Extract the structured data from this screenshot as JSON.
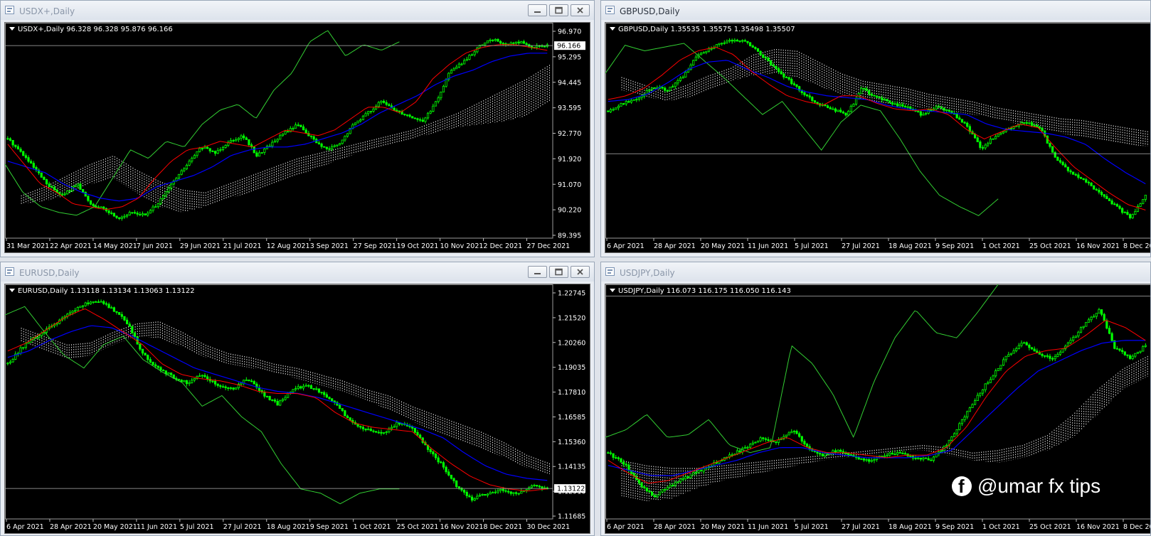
{
  "windows": [
    {
      "id": "usdx",
      "title": "USDX+,Daily",
      "active": false,
      "buttons": true,
      "info": "USDX+,Daily  96.328 96.328 95.876 96.166",
      "price_labels": [
        "96.970",
        "95.295",
        "94.445",
        "93.595",
        "92.770",
        "91.920",
        "91.070",
        "90.220",
        "89.395"
      ],
      "current_price": "96.166",
      "date_labels": [
        "31 Mar 2021",
        "22 Apr 2021",
        "14 May 2021",
        "7 Jun 2021",
        "29 Jun 2021",
        "21 Jul 2021",
        "12 Aug 2021",
        "3 Sep 2021",
        "27 Sep 2021",
        "19 Oct 2021",
        "10 Nov 2021",
        "2 Dec 2021",
        "27 Dec 2021"
      ]
    },
    {
      "id": "gbpusd",
      "title": "GBPUSD,Daily",
      "active": true,
      "buttons": false,
      "info": "GBPUSD,Daily  1.35535 1.35575 1.35498 1.35507",
      "price_labels": [],
      "current_price": "",
      "date_labels": [
        "6 Apr 2021",
        "28 Apr 2021",
        "20 May 2021",
        "11 Jun 2021",
        "5 Jul 2021",
        "27 Jul 2021",
        "18 Aug 2021",
        "9 Sep 2021",
        "1 Oct 2021",
        "25 Oct 2021",
        "16 Nov 2021",
        "8 Dec 20"
      ]
    },
    {
      "id": "eurusd",
      "title": "EURUSD,Daily",
      "active": false,
      "buttons": true,
      "info": "EURUSD,Daily  1.13118 1.13134 1.13063 1.13122",
      "price_labels": [
        "1.22745",
        "1.21520",
        "1.20260",
        "1.19035",
        "1.17810",
        "1.16585",
        "1.15360",
        "1.14135",
        "1.12910",
        "1.11685"
      ],
      "current_price": "1.13122",
      "date_labels": [
        "6 Apr 2021",
        "28 Apr 2021",
        "20 May 2021",
        "11 Jun 2021",
        "5 Jul 2021",
        "27 Jul 2021",
        "18 Aug 2021",
        "9 Sep 2021",
        "1 Oct 2021",
        "25 Oct 2021",
        "16 Nov 2021",
        "8 Dec 2021",
        "30 Dec 2021"
      ]
    },
    {
      "id": "usdjpy",
      "title": "USDJPY,Daily",
      "active": false,
      "buttons": false,
      "info": "USDJPY,Daily  116.073 116.175 116.050 116.143",
      "price_labels": [],
      "current_price": "",
      "date_labels": [
        "6 Apr 2021",
        "28 Apr 2021",
        "20 May 2021",
        "11 Jun 2021",
        "5 Jul 2021",
        "27 Jul 2021",
        "18 Aug 2021",
        "9 Sep 2021",
        "1 Oct 2021",
        "25 Oct 2021",
        "16 Nov 2021",
        "8 Dec 20"
      ]
    }
  ],
  "icons": {
    "window": "chart-window-icon",
    "minimize": "minimize-icon",
    "maximize": "maximize-icon",
    "close": "close-icon",
    "dropdown": "triangle-down-icon",
    "facebook": "facebook-icon"
  },
  "colors": {
    "candles": "#00ff00",
    "tenkan": "#ff0000",
    "kijun": "#0000ff",
    "chikou": "#32cd32",
    "cloud_bull": "#f4a460",
    "cloud_bear": "#ffffff",
    "chart_bg": "#000000"
  },
  "watermark": "@umar fx tips",
  "chart_data": [
    {
      "type": "candlestick",
      "symbol": "USDX+",
      "timeframe": "Daily",
      "open": 96.328,
      "high": 96.328,
      "low": 95.876,
      "close": 96.166,
      "ylim": [
        89.395,
        96.97
      ],
      "x_range": [
        "31 Mar 2021",
        "27 Dec 2021"
      ],
      "close_path": [
        92.9,
        92.4,
        91.8,
        91.2,
        90.9,
        91.3,
        90.6,
        90.4,
        90.1,
        90.3,
        90.2,
        90.7,
        91.4,
        92.0,
        92.6,
        92.4,
        92.8,
        93.0,
        92.3,
        92.7,
        93.1,
        93.4,
        92.9,
        92.5,
        92.7,
        93.4,
        93.8,
        94.2,
        93.9,
        93.7,
        93.5,
        94.2,
        95.3,
        95.6,
        96.1,
        96.4,
        96.2,
        96.3,
        96.1,
        96.2
      ],
      "tenkan_path": [
        92.7,
        92.0,
        91.3,
        91.0,
        90.6,
        90.5,
        90.4,
        90.5,
        90.8,
        91.5,
        92.1,
        92.5,
        92.6,
        92.8,
        92.7,
        92.6,
        92.9,
        93.2,
        93.1,
        93.0,
        93.2,
        93.6,
        94.0,
        94.0,
        93.8,
        94.2,
        95.0,
        95.5,
        95.9,
        96.1,
        96.2,
        96.2,
        96.1,
        96.0
      ],
      "kijun_path": [
        92.1,
        91.9,
        91.7,
        91.3,
        91.0,
        90.8,
        90.7,
        90.8,
        91.2,
        91.4,
        91.6,
        91.9,
        92.3,
        92.5,
        92.6,
        92.6,
        92.7,
        92.9,
        93.1,
        93.4,
        93.8,
        94.1,
        94.4,
        94.8,
        95.1,
        95.3,
        95.6,
        95.8,
        95.9,
        95.9
      ],
      "chikou_path": [
        92.0,
        91.0,
        90.5,
        90.3,
        90.2,
        90.5,
        91.5,
        92.5,
        92.2,
        92.8,
        92.6,
        93.4,
        93.9,
        94.1,
        93.6,
        94.6,
        95.2,
        96.3,
        96.7,
        95.8,
        96.2,
        96.0,
        96.3
      ],
      "cloud_top": [
        90.9,
        91.2,
        91.6,
        92.0,
        92.3,
        91.8,
        91.4,
        91.1,
        91.0,
        91.3,
        91.6,
        91.9,
        92.2,
        92.4,
        92.6,
        92.8,
        93.0,
        93.2,
        93.5,
        93.8,
        94.2,
        94.6,
        95.0,
        95.5
      ],
      "cloud_bottom": [
        90.6,
        90.7,
        90.9,
        91.3,
        91.5,
        91.0,
        90.5,
        90.3,
        90.5,
        90.8,
        91.0,
        91.3,
        91.6,
        91.9,
        92.2,
        92.5,
        92.7,
        92.9,
        93.1,
        93.3,
        93.4,
        93.5,
        93.7,
        94.2
      ]
    },
    {
      "type": "candlestick",
      "symbol": "GBPUSD",
      "timeframe": "Daily",
      "open": 1.35535,
      "high": 1.35575,
      "low": 1.35498,
      "close": 1.35507,
      "ylim": [
        1.31,
        1.425
      ],
      "x_range": [
        "6 Apr 2021",
        "8 Dec 20"
      ],
      "close_path": [
        1.378,
        1.382,
        1.385,
        1.391,
        1.389,
        1.396,
        1.408,
        1.412,
        1.415,
        1.416,
        1.41,
        1.402,
        1.395,
        1.388,
        1.382,
        1.379,
        1.376,
        1.39,
        1.385,
        1.382,
        1.38,
        1.376,
        1.38,
        1.377,
        1.37,
        1.358,
        1.365,
        1.369,
        1.372,
        1.368,
        1.352,
        1.345,
        1.34,
        1.334,
        1.327,
        1.321,
        1.333
      ],
      "tenkan_path": [
        1.384,
        1.386,
        1.39,
        1.397,
        1.405,
        1.41,
        1.412,
        1.408,
        1.399,
        1.392,
        1.386,
        1.383,
        1.381,
        1.386,
        1.386,
        1.382,
        1.379,
        1.378,
        1.379,
        1.376,
        1.368,
        1.363,
        1.367,
        1.371,
        1.369,
        1.358,
        1.348,
        1.341,
        1.334,
        1.328,
        1.325
      ],
      "kijun_path": [
        1.383,
        1.384,
        1.387,
        1.393,
        1.4,
        1.404,
        1.405,
        1.4,
        1.396,
        1.391,
        1.388,
        1.386,
        1.385,
        1.384,
        1.381,
        1.379,
        1.378,
        1.377,
        1.376,
        1.371,
        1.368,
        1.367,
        1.366,
        1.364,
        1.36,
        1.352,
        1.345,
        1.339
      ],
      "chikou_path": [
        1.398,
        1.413,
        1.41,
        1.412,
        1.414,
        1.405,
        1.396,
        1.386,
        1.376,
        1.383,
        1.37,
        1.357,
        1.372,
        1.381,
        1.378,
        1.363,
        1.346,
        1.333,
        1.327,
        1.322,
        1.331
      ],
      "cloud_top": [
        1.396,
        1.392,
        1.388,
        1.392,
        1.397,
        1.401,
        1.408,
        1.411,
        1.41,
        1.404,
        1.398,
        1.394,
        1.392,
        1.39,
        1.387,
        1.385,
        1.383,
        1.38,
        1.378,
        1.376,
        1.374,
        1.373,
        1.371,
        1.369,
        1.367
      ],
      "cloud_bottom": [
        1.389,
        1.386,
        1.383,
        1.385,
        1.389,
        1.394,
        1.397,
        1.398,
        1.396,
        1.391,
        1.387,
        1.384,
        1.382,
        1.381,
        1.379,
        1.378,
        1.376,
        1.374,
        1.371,
        1.369,
        1.366,
        1.364,
        1.362,
        1.36,
        1.359
      ]
    },
    {
      "type": "candlestick",
      "symbol": "EURUSD",
      "timeframe": "Daily",
      "open": 1.13118,
      "high": 1.13134,
      "low": 1.13063,
      "close": 1.13122,
      "ylim": [
        1.11685,
        1.22745
      ],
      "x_range": [
        "6 Apr 2021",
        "30 Dec 2021"
      ],
      "close_path": [
        1.19,
        1.198,
        1.203,
        1.208,
        1.213,
        1.218,
        1.22,
        1.216,
        1.209,
        1.195,
        1.188,
        1.184,
        1.181,
        1.185,
        1.18,
        1.178,
        1.183,
        1.176,
        1.171,
        1.178,
        1.18,
        1.176,
        1.17,
        1.162,
        1.159,
        1.157,
        1.162,
        1.16,
        1.15,
        1.142,
        1.132,
        1.126,
        1.129,
        1.131,
        1.128,
        1.133,
        1.131
      ],
      "tenkan_path": [
        1.196,
        1.2,
        1.206,
        1.212,
        1.216,
        1.211,
        1.205,
        1.199,
        1.19,
        1.185,
        1.183,
        1.182,
        1.18,
        1.177,
        1.176,
        1.176,
        1.174,
        1.167,
        1.162,
        1.16,
        1.159,
        1.158,
        1.15,
        1.143,
        1.137,
        1.133,
        1.131,
        1.13,
        1.131
      ],
      "kijun_path": [
        1.193,
        1.196,
        1.201,
        1.205,
        1.208,
        1.207,
        1.203,
        1.198,
        1.193,
        1.188,
        1.185,
        1.182,
        1.179,
        1.177,
        1.176,
        1.174,
        1.171,
        1.168,
        1.165,
        1.162,
        1.159,
        1.155,
        1.148,
        1.142,
        1.138,
        1.136,
        1.135
      ],
      "chikou_path": [
        1.213,
        1.217,
        1.205,
        1.194,
        1.188,
        1.199,
        1.203,
        1.192,
        1.186,
        1.181,
        1.17,
        1.175,
        1.165,
        1.158,
        1.143,
        1.131,
        1.129,
        1.124,
        1.129,
        1.131,
        1.131
      ],
      "cloud_top": [
        1.207,
        1.203,
        1.199,
        1.2,
        1.205,
        1.209,
        1.21,
        1.205,
        1.199,
        1.195,
        1.193,
        1.19,
        1.188,
        1.185,
        1.182,
        1.178,
        1.175,
        1.17,
        1.166,
        1.162,
        1.158,
        1.153,
        1.147,
        1.143
      ],
      "cloud_bottom": [
        1.2,
        1.196,
        1.192,
        1.194,
        1.199,
        1.203,
        1.202,
        1.198,
        1.193,
        1.19,
        1.188,
        1.186,
        1.183,
        1.18,
        1.177,
        1.173,
        1.168,
        1.163,
        1.158,
        1.154,
        1.15,
        1.146,
        1.141,
        1.138
      ]
    },
    {
      "type": "candlestick",
      "symbol": "USDJPY",
      "timeframe": "Daily",
      "open": 116.073,
      "high": 116.175,
      "low": 116.05,
      "close": 116.143,
      "ylim": [
        107.4,
        116.6
      ],
      "x_range": [
        "6 Apr 2021",
        "8 Dec 20"
      ],
      "close_path": [
        110.0,
        109.6,
        108.8,
        108.3,
        108.7,
        109.0,
        109.3,
        109.6,
        109.9,
        110.2,
        110.6,
        110.4,
        110.9,
        110.2,
        109.9,
        110.1,
        109.8,
        109.7,
        109.9,
        110.0,
        109.8,
        109.7,
        110.3,
        111.2,
        112.2,
        113.0,
        113.8,
        114.3,
        113.9,
        113.7,
        114.3,
        115.0,
        115.6,
        114.1,
        113.7,
        114.2
      ],
      "tenkan_path": [
        109.7,
        109.2,
        108.8,
        108.9,
        109.2,
        109.5,
        109.8,
        110.1,
        110.4,
        110.6,
        110.2,
        110.0,
        110.0,
        109.9,
        109.8,
        109.9,
        109.9,
        110.2,
        111.0,
        112.2,
        113.2,
        113.8,
        114.0,
        114.1,
        114.6,
        115.2,
        114.9,
        114.4
      ],
      "kijun_path": [
        109.5,
        109.3,
        109.1,
        109.1,
        109.3,
        109.5,
        109.7,
        110.0,
        110.2,
        110.2,
        110.0,
        109.9,
        109.8,
        109.8,
        109.8,
        109.9,
        110.1,
        110.9,
        111.7,
        112.5,
        113.2,
        113.6,
        114.0,
        114.3,
        114.4,
        114.4
      ],
      "chikou_path": [
        110.6,
        110.9,
        111.5,
        110.6,
        110.7,
        111.3,
        110.3,
        110.0,
        110.2,
        114.2,
        113.5,
        112.3,
        110.6,
        112.8,
        114.5,
        115.6,
        114.7,
        114.5,
        115.5,
        116.6
      ],
      "cloud_top": [
        109.7,
        109.5,
        109.4,
        109.4,
        109.5,
        109.6,
        109.7,
        109.8,
        109.9,
        110.0,
        110.1,
        110.2,
        110.3,
        110.2,
        110.0,
        110.1,
        110.3,
        110.7,
        111.5,
        112.5,
        113.3,
        113.8
      ],
      "cloud_bottom": [
        108.3,
        108.1,
        108.2,
        108.6,
        108.9,
        109.1,
        109.3,
        109.5,
        109.7,
        109.8,
        109.9,
        110.0,
        110.1,
        109.9,
        109.7,
        109.6,
        109.8,
        110.1,
        110.6,
        111.5,
        112.5,
        113.0
      ]
    }
  ]
}
